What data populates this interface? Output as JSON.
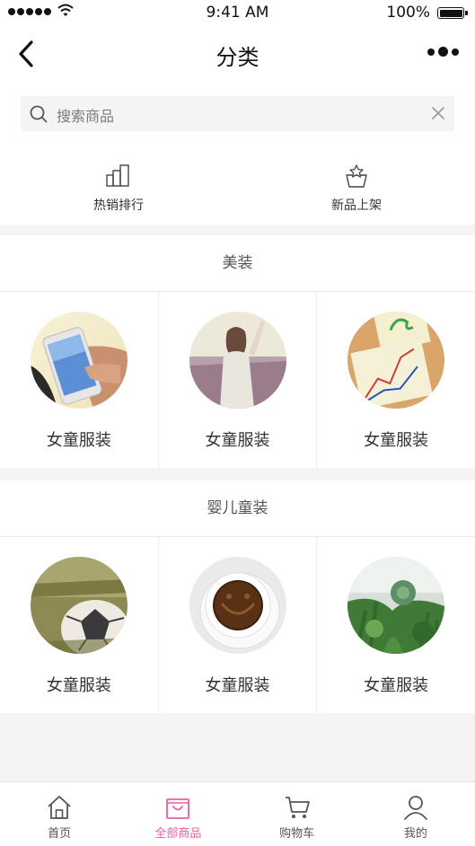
{
  "status_bar": {
    "time": "9:41 AM",
    "battery": "100%"
  },
  "navbar": {
    "title": "分类"
  },
  "search": {
    "placeholder": "搜索商品"
  },
  "quick_links": [
    {
      "label": "热销排行",
      "icon": "bar-chart-icon"
    },
    {
      "label": "新品上架",
      "icon": "new-arrival-icon"
    }
  ],
  "sections": [
    {
      "title": "美装",
      "items": [
        {
          "label": "女童服装",
          "image": "phone-in-hand-photo"
        },
        {
          "label": "女童服装",
          "image": "girl-by-sea-photo"
        },
        {
          "label": "女童服装",
          "image": "charts-on-paper-photo"
        }
      ]
    },
    {
      "title": "婴儿童装",
      "items": [
        {
          "label": "女童服装",
          "image": "football-on-grass-photo"
        },
        {
          "label": "女童服装",
          "image": "coffee-cup-photo"
        },
        {
          "label": "女童服装",
          "image": "succulent-plants-photo"
        }
      ]
    }
  ],
  "tabbar": {
    "tabs": [
      {
        "label": "首页",
        "icon": "home-icon"
      },
      {
        "label": "全部商品",
        "icon": "shopping-bag-icon",
        "active": true
      },
      {
        "label": "购物车",
        "icon": "cart-icon"
      },
      {
        "label": "我的",
        "icon": "user-icon"
      }
    ],
    "active_color": "#e95ea0"
  }
}
